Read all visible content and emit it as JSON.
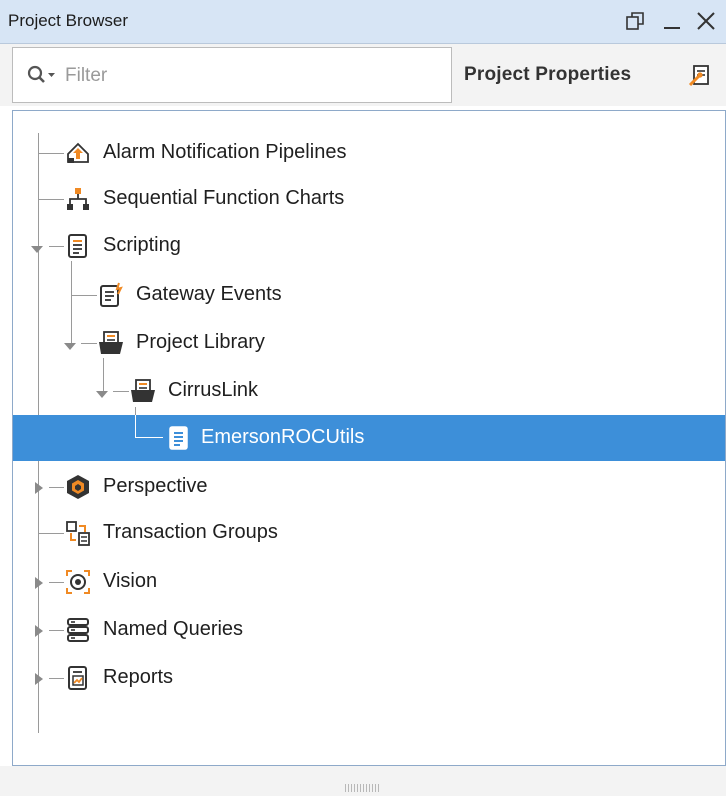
{
  "window": {
    "title": "Project Browser"
  },
  "filter": {
    "placeholder": "Filter",
    "value": ""
  },
  "project_properties": {
    "label": "Project Properties"
  },
  "tree": {
    "items": [
      {
        "label": "Alarm Notification Pipelines",
        "icon": "alarm-pipeline-icon",
        "expanded": null
      },
      {
        "label": "Sequential Function Charts",
        "icon": "sfc-icon",
        "expanded": null
      },
      {
        "label": "Scripting",
        "icon": "scripting-icon",
        "expanded": true
      },
      {
        "label": "Gateway Events",
        "icon": "gateway-events-icon",
        "expanded": null
      },
      {
        "label": "Project Library",
        "icon": "folder-icon",
        "expanded": true
      },
      {
        "label": "CirrusLink",
        "icon": "folder-icon",
        "expanded": true
      },
      {
        "label": "EmersonROCUtils",
        "icon": "script-file-icon",
        "expanded": null,
        "selected": true
      },
      {
        "label": "Perspective",
        "icon": "perspective-icon",
        "expanded": false
      },
      {
        "label": "Transaction Groups",
        "icon": "transaction-groups-icon",
        "expanded": null
      },
      {
        "label": "Vision",
        "icon": "vision-icon",
        "expanded": false
      },
      {
        "label": "Named Queries",
        "icon": "named-queries-icon",
        "expanded": false
      },
      {
        "label": "Reports",
        "icon": "reports-icon",
        "expanded": false
      }
    ]
  },
  "colors": {
    "titlebar": "#d7e5f5",
    "selection": "#3d8fd9",
    "accent_orange": "#f08a24"
  }
}
